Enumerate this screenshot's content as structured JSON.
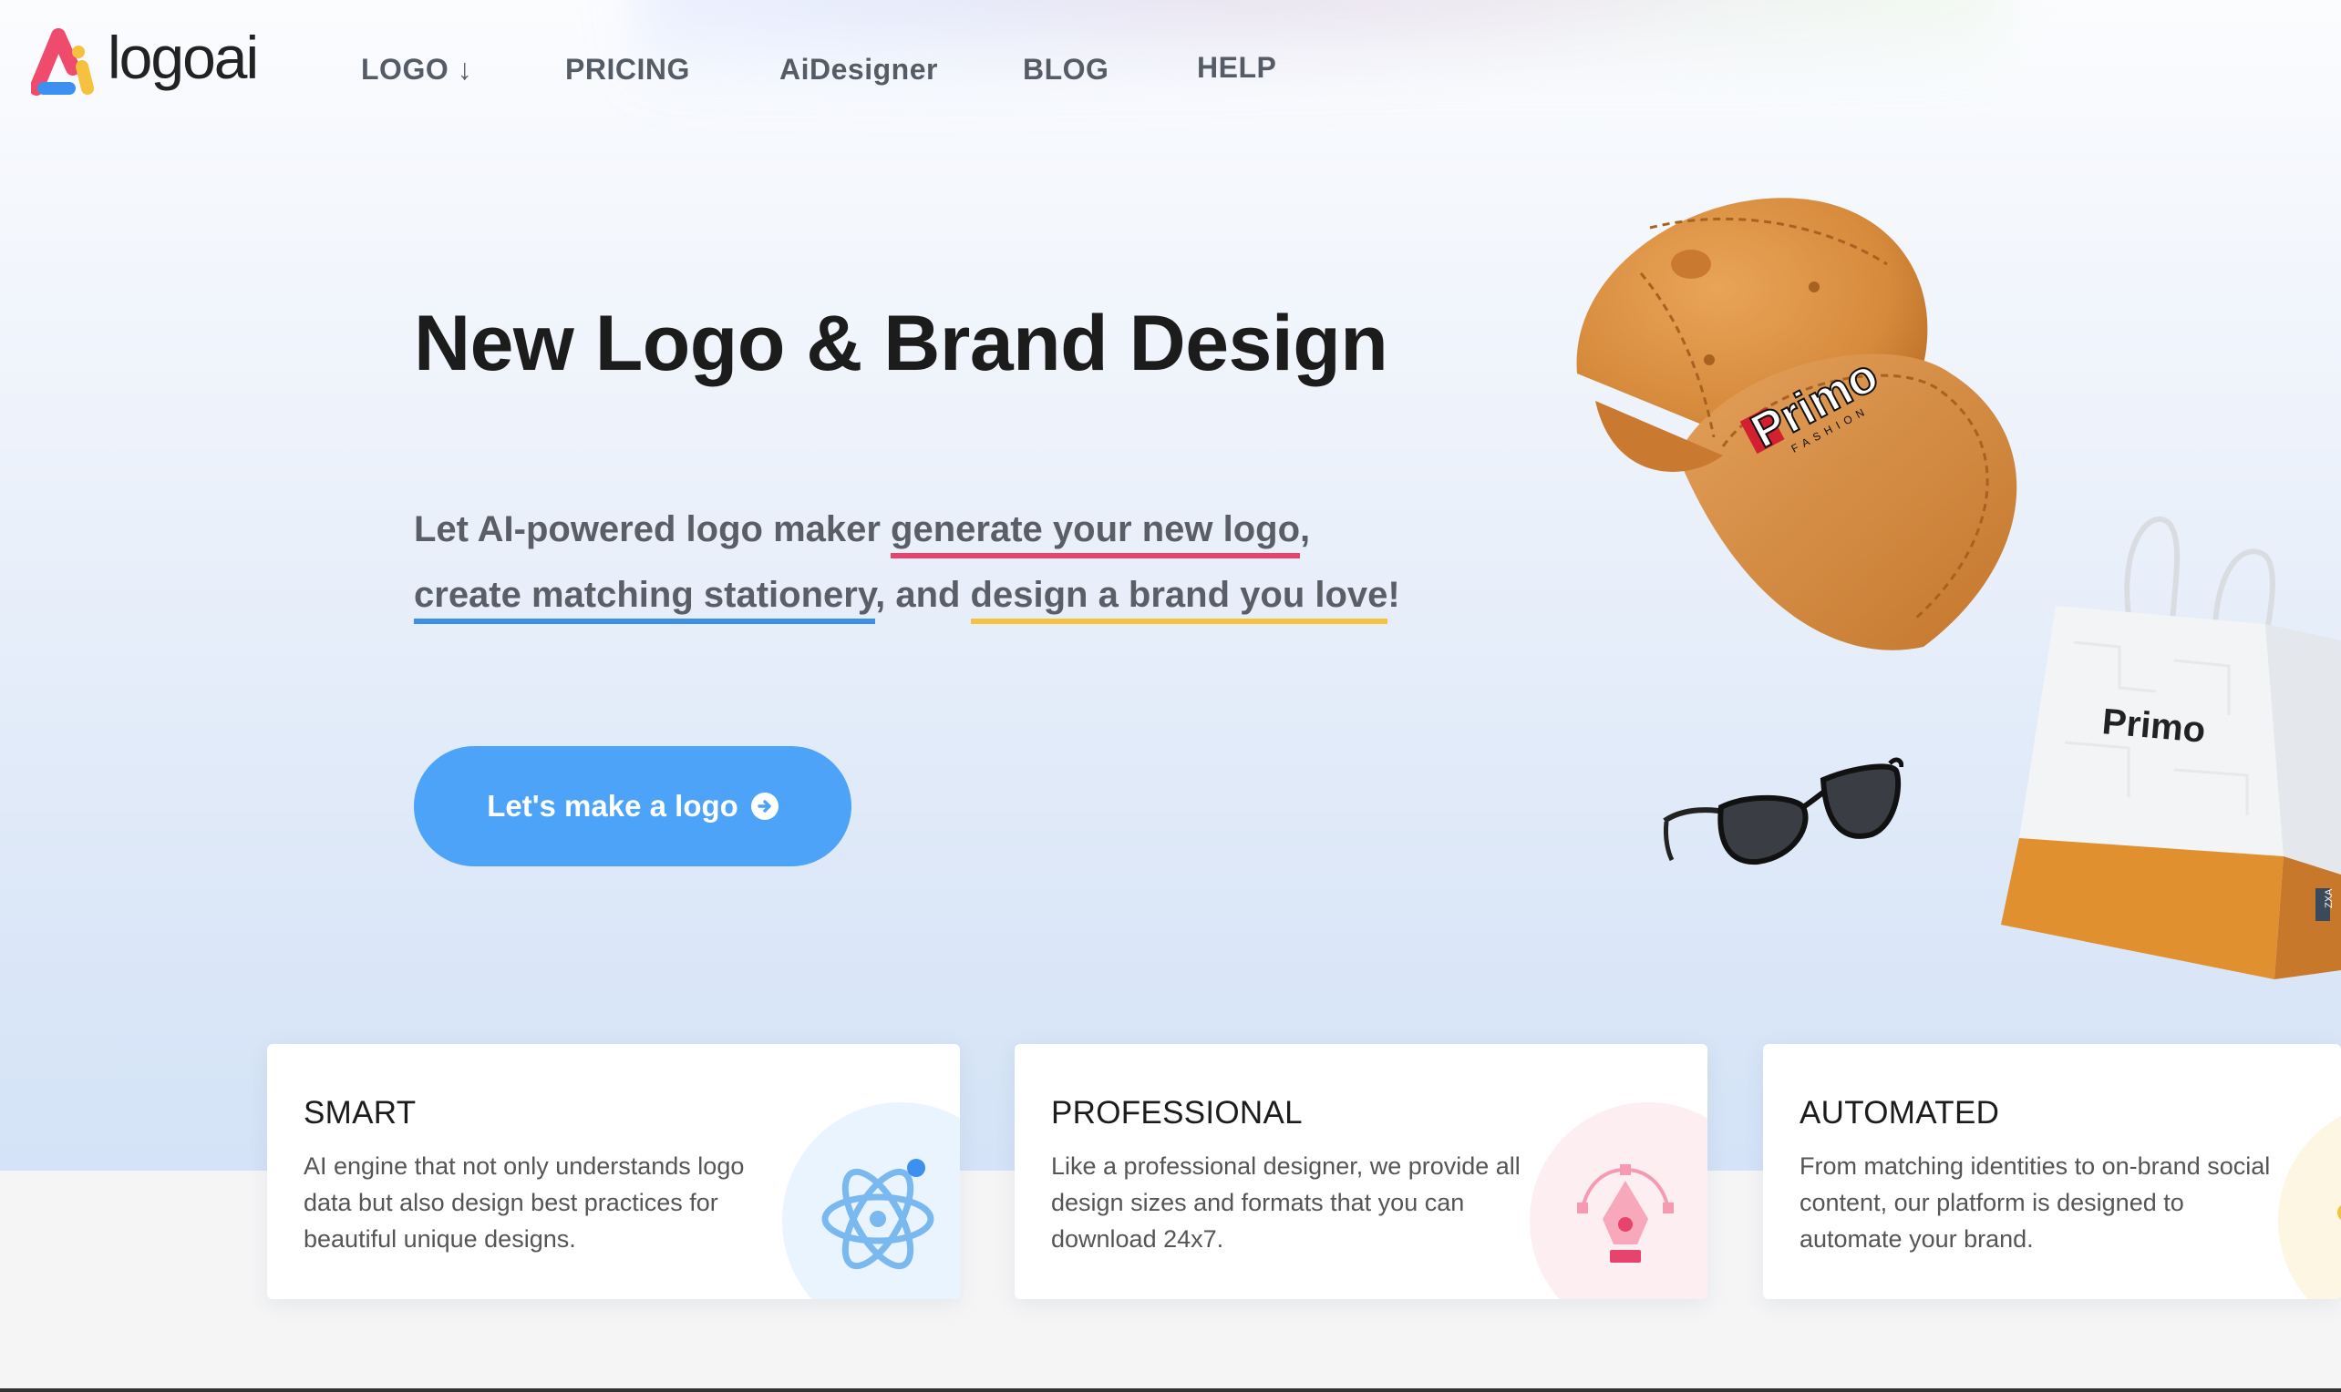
{
  "brand": {
    "name": "logoai"
  },
  "nav": {
    "items": [
      {
        "label": "LOGO ↓"
      },
      {
        "label": "PRICING"
      },
      {
        "label": "AiDesigner"
      },
      {
        "label": "BLOG"
      },
      {
        "label": "HELP"
      }
    ]
  },
  "hero": {
    "title": "New Logo & Brand Design",
    "sub_intro": "Let AI-powered logo maker ",
    "sub_link1": "generate your new logo",
    "sub_comma": ",",
    "sub_link2": "create matching stationery",
    "sub_and": ", and ",
    "sub_link3": "design a brand you love",
    "sub_end": "!",
    "cta_label": "Let's make a logo"
  },
  "products": {
    "brand_mark": "Primo",
    "cap_caption": "FASHION",
    "bag_tag": "ZXA"
  },
  "features": [
    {
      "title": "SMART",
      "text": "AI engine that not only understands logo data but also design best practices for beautiful unique designs.",
      "icon": "atom-icon",
      "color": "#eaf4ff"
    },
    {
      "title": "PROFESSIONAL",
      "text": "Like a professional designer, we provide all design sizes and formats that you can download 24x7.",
      "icon": "pen-tool-icon",
      "color": "#fdeef2"
    },
    {
      "title": "AUTOMATED",
      "text": "From matching identities to on-brand social content, our platform is designed to automate your brand.",
      "icon": "automation-icon",
      "color": "#fdf6e3"
    }
  ],
  "colors": {
    "accent": "#4ca3f7",
    "underline_red": "#e8436d",
    "underline_blue": "#3f8fe6",
    "underline_yellow": "#f5c13f"
  }
}
